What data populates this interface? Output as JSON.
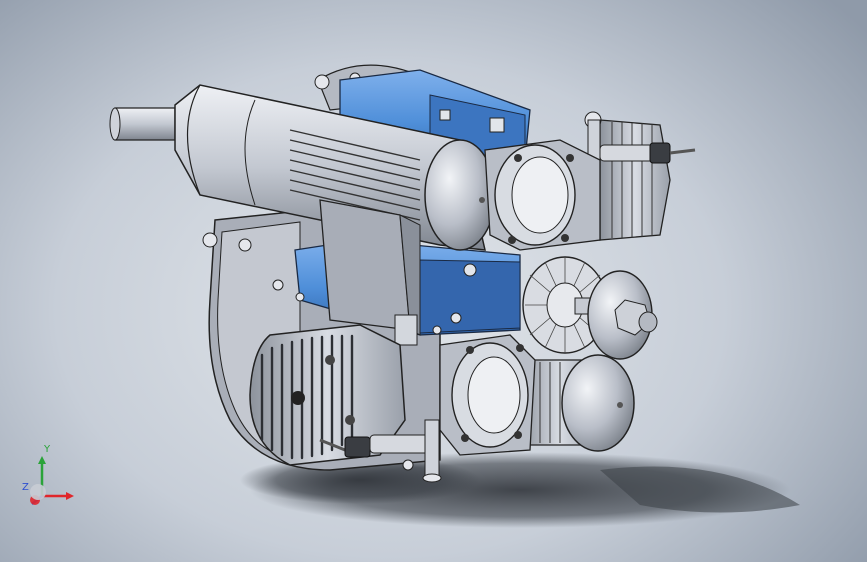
{
  "viewport": {
    "background_top": "#c9d0d9",
    "background_center": "#e2e6ea",
    "background_edge": "#8f9aa9"
  },
  "colors": {
    "metal_light": "#dcdfe6",
    "metal_mid": "#b7bcc7",
    "metal_dark": "#7c818b",
    "blue_part": "#4f8fd9",
    "blue_dark": "#2e62a8",
    "edge": "#222222",
    "shadow": "#3a3f46"
  },
  "triad": {
    "y_label": "Y",
    "z_label": "Z",
    "x_color": "#e0262b",
    "y_color": "#2aa339",
    "z_color": "#2d4fd0"
  },
  "model": {
    "icon": "engine-model",
    "parts": [
      "exhaust-muffler",
      "cylinder-upper",
      "cylinder-lower",
      "crankcase",
      "mount-plate",
      "propeller-hub",
      "spark-plug-upper",
      "spark-plug-lower"
    ]
  }
}
